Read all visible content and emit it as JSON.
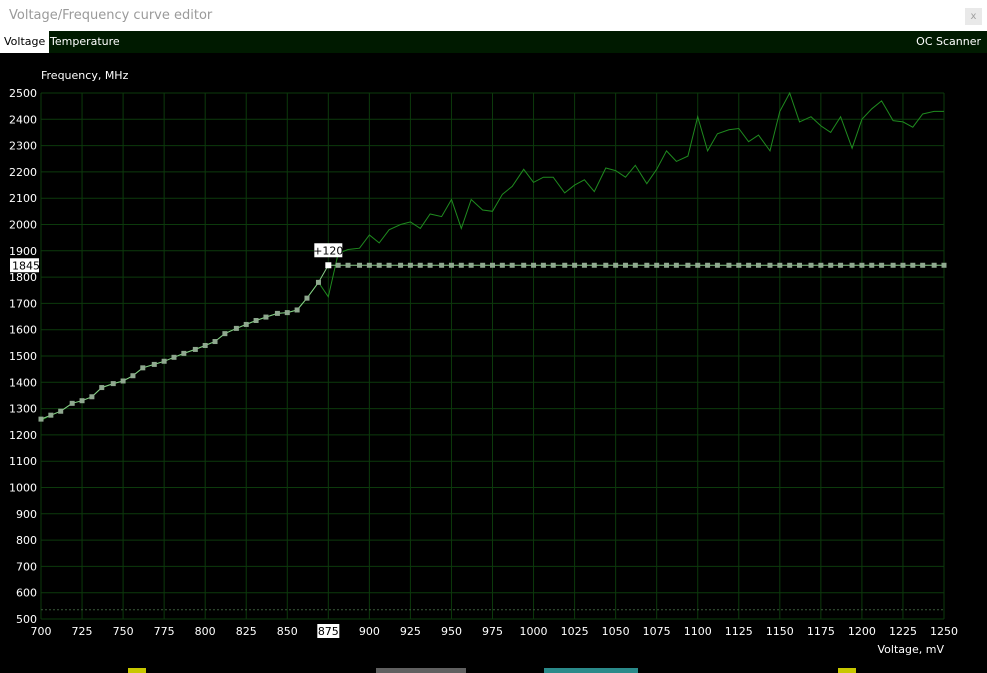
{
  "window": {
    "title": "Voltage/Frequency curve editor",
    "close_glyph": "x"
  },
  "tabs": [
    {
      "label": "Voltage",
      "active": true
    },
    {
      "label": "Temperature",
      "active": false
    },
    {
      "label": "OC Scanner",
      "active": false
    }
  ],
  "colors": {
    "background": "#000000",
    "grid": "#0c3a0c",
    "reference_curve": "#1f8a1f",
    "vf_curve": "#88cc88",
    "vf_point": "#8fa88f",
    "selected_point": "#ffffff",
    "tab_bar": "#001a00"
  },
  "chart_data": {
    "type": "line",
    "ylabel": "Frequency, MHz",
    "xlabel": "Voltage, mV",
    "xlim": [
      700,
      1250
    ],
    "ylim": [
      500,
      2500
    ],
    "x_ticks": [
      700,
      725,
      750,
      775,
      800,
      825,
      850,
      875,
      900,
      925,
      950,
      975,
      1000,
      1025,
      1050,
      1075,
      1100,
      1125,
      1150,
      1175,
      1200,
      1225,
      1250
    ],
    "y_ticks": [
      500,
      600,
      700,
      800,
      900,
      1000,
      1100,
      1200,
      1300,
      1400,
      1500,
      1600,
      1700,
      1800,
      1900,
      2000,
      2100,
      2200,
      2300,
      2400,
      2500
    ],
    "grid": true,
    "selected_point": {
      "x": 875,
      "y": 1845,
      "x_label": "875",
      "y_label": "1845",
      "offset_label": "+120"
    },
    "reference_floor_y": 535,
    "series": [
      {
        "x": [
          700,
          706,
          712,
          719,
          725,
          731,
          737,
          744,
          750,
          756,
          762,
          769,
          775,
          781,
          787,
          794,
          800,
          806,
          812,
          819,
          825,
          831,
          837,
          844,
          850,
          856,
          862,
          869,
          875,
          881,
          887,
          894,
          900,
          906,
          912,
          919,
          925,
          931,
          937,
          944,
          950,
          956,
          962,
          969,
          975,
          981,
          987,
          994,
          1000,
          1006,
          1012,
          1019,
          1025,
          1031,
          1037,
          1044,
          1050,
          1056,
          1062,
          1069,
          1075,
          1081,
          1087,
          1094,
          1100,
          1106,
          1112,
          1119,
          1125,
          1131,
          1137,
          1144,
          1150,
          1156,
          1162,
          1169,
          1175,
          1181,
          1187,
          1194,
          1200,
          1206,
          1212,
          1219,
          1225,
          1231,
          1237,
          1244,
          1250
        ],
        "y": [
          1255,
          1275,
          1290,
          1320,
          1330,
          1345,
          1380,
          1395,
          1405,
          1425,
          1455,
          1468,
          1480,
          1495,
          1510,
          1525,
          1540,
          1555,
          1585,
          1605,
          1620,
          1635,
          1648,
          1662,
          1665,
          1675,
          1720,
          1780,
          1725,
          1890,
          1905,
          1910,
          1960,
          1930,
          1980,
          2000,
          2010,
          1985,
          2040,
          2030,
          2095,
          1985,
          2095,
          2055,
          2050,
          2115,
          2145,
          2210,
          2160,
          2180,
          2180,
          2120,
          2150,
          2170,
          2125,
          2215,
          2205,
          2180,
          2225,
          2155,
          2210,
          2280,
          2240,
          2260,
          2410,
          2280,
          2345,
          2360,
          2365,
          2315,
          2340,
          2280,
          2430,
          2500,
          2390,
          2410,
          2375,
          2350,
          2410,
          2290,
          2400,
          2440,
          2470,
          2395,
          2390,
          2370,
          2420,
          2430,
          2430
        ]
      },
      {
        "x": [
          700,
          706,
          712,
          719,
          725,
          731,
          737,
          744,
          750,
          756,
          762,
          769,
          775,
          781,
          787,
          794,
          800,
          806,
          812,
          819,
          825,
          831,
          837,
          844,
          850,
          856,
          862,
          869,
          875,
          881,
          887,
          894,
          900,
          906,
          912,
          919,
          925,
          931,
          937,
          944,
          950,
          956,
          962,
          969,
          975,
          981,
          987,
          994,
          1000,
          1006,
          1012,
          1019,
          1025,
          1031,
          1037,
          1044,
          1050,
          1056,
          1062,
          1069,
          1075,
          1081,
          1087,
          1094,
          1100,
          1106,
          1112,
          1119,
          1125,
          1131,
          1137,
          1144,
          1150,
          1156,
          1162,
          1169,
          1175,
          1181,
          1187,
          1194,
          1200,
          1206,
          1212,
          1219,
          1225,
          1231,
          1237,
          1244,
          1250
        ],
        "y": [
          1260,
          1275,
          1290,
          1320,
          1330,
          1345,
          1380,
          1395,
          1405,
          1425,
          1455,
          1468,
          1480,
          1495,
          1510,
          1525,
          1540,
          1555,
          1585,
          1605,
          1620,
          1635,
          1648,
          1662,
          1665,
          1675,
          1720,
          1780,
          1845,
          1845,
          1845,
          1845,
          1845,
          1845,
          1845,
          1845,
          1845,
          1845,
          1845,
          1845,
          1845,
          1845,
          1845,
          1845,
          1845,
          1845,
          1845,
          1845,
          1845,
          1845,
          1845,
          1845,
          1845,
          1845,
          1845,
          1845,
          1845,
          1845,
          1845,
          1845,
          1845,
          1845,
          1845,
          1845,
          1845,
          1845,
          1845,
          1845,
          1845,
          1845,
          1845,
          1845,
          1845,
          1845,
          1845,
          1845,
          1845,
          1845,
          1845,
          1845,
          1845,
          1845,
          1845,
          1845,
          1845,
          1845,
          1845,
          1845,
          1845
        ]
      }
    ]
  }
}
